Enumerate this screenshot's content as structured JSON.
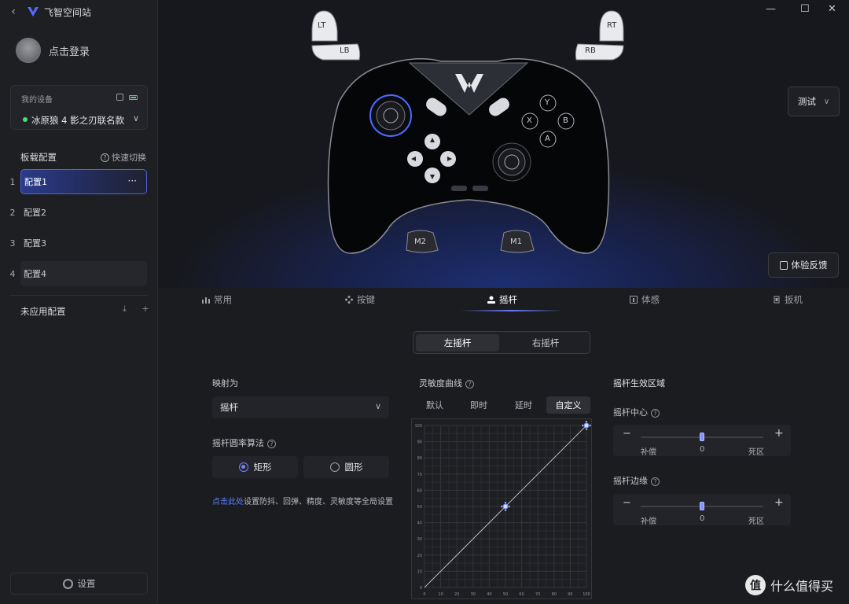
{
  "app": {
    "title": "飞智空间站",
    "back": "‹"
  },
  "user": {
    "login": "点击登录"
  },
  "device": {
    "label": "我的设备",
    "name": "冰原狼 4 影之刃联名款",
    "chevron": "∨"
  },
  "onboard": {
    "title": "板载配置",
    "quick_switch": "快速切换",
    "help": "?",
    "configs": [
      {
        "index": "1",
        "name": "配置1",
        "more": "···"
      },
      {
        "index": "2",
        "name": "配置2"
      },
      {
        "index": "3",
        "name": "配置3"
      },
      {
        "index": "4",
        "name": "配置4"
      }
    ]
  },
  "unapplied": {
    "title": "未应用配置",
    "icons": "⤓ +"
  },
  "settings": {
    "label": "设置"
  },
  "window": {
    "minimize": "—",
    "maximize": "☐",
    "close": "✕"
  },
  "controller": {
    "lt": "LT",
    "lb": "LB",
    "rt": "RT",
    "rb": "RB",
    "y": "Y",
    "x": "X",
    "b": "B",
    "a": "A",
    "m1": "M1",
    "m2": "M2"
  },
  "test": {
    "label": "测试",
    "chevron": "∨"
  },
  "feedback": {
    "label": "体验反馈"
  },
  "tabs": [
    {
      "label": "常用",
      "icon": "bar-chart-icon"
    },
    {
      "label": "按键",
      "icon": "dpad-icon"
    },
    {
      "label": "摇杆",
      "icon": "joystick-icon"
    },
    {
      "label": "体感",
      "icon": "motion-icon"
    },
    {
      "label": "扳机",
      "icon": "trigger-icon"
    }
  ],
  "stick_select": {
    "left": "左摇杆",
    "right": "右摇杆"
  },
  "mapping": {
    "label": "映射为",
    "value": "摇杆",
    "chevron": "∨"
  },
  "algo": {
    "label": "摇杆圆率算法",
    "option_rect": "矩形",
    "option_round": "圆形",
    "selected": "矩形"
  },
  "hint": {
    "link": "点击此处",
    "text": "设置防抖、回弹、精度、灵敏度等全局设置"
  },
  "curve": {
    "title": "灵敏度曲线",
    "tabs": [
      "默认",
      "即时",
      "延时",
      "自定义"
    ],
    "selected": "自定义",
    "x_ticks": [
      "0",
      "10",
      "20",
      "30",
      "40",
      "50",
      "60",
      "70",
      "80",
      "90",
      "100"
    ],
    "y_ticks": [
      "100",
      "90",
      "80",
      "70",
      "60",
      "50",
      "40",
      "30",
      "20",
      "10",
      "0"
    ]
  },
  "zone": {
    "title": "摇杆生效区域",
    "center": {
      "label": "摇杆中心",
      "minus": "−",
      "plus": "+",
      "left": "补偿",
      "value": "0",
      "right": "死区"
    },
    "edge": {
      "label": "摇杆边缘",
      "minus": "−",
      "plus": "+",
      "left": "补偿",
      "value": "0",
      "right": "死区"
    }
  },
  "watermark": {
    "logo": "值",
    "text": "什么值得买"
  },
  "colors": {
    "accent": "#6f84ff",
    "link": "#5c7cff",
    "active_gradient": "#2b3b8c",
    "status_green": "#4ade6c"
  }
}
